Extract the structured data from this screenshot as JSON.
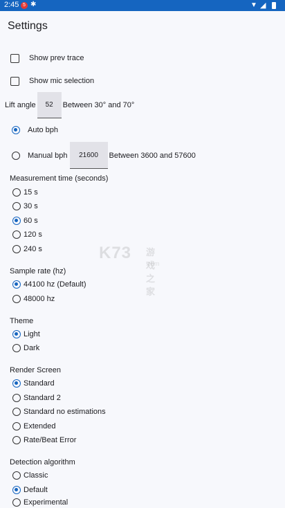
{
  "status_bar": {
    "time": "2:45",
    "notification_badge": "5",
    "app_icon": "bug-icon",
    "wifi_icon": "wifi-icon",
    "signal_icon": "signal-icon",
    "battery_icon": "battery-icon"
  },
  "title": "Settings",
  "checkboxes": [
    {
      "label": "Show prev trace",
      "checked": false
    },
    {
      "label": "Show mic selection",
      "checked": false
    }
  ],
  "lift_angle": {
    "label": "Lift angle",
    "value": "52",
    "hint": "Between 30° and 70°"
  },
  "bph": {
    "auto_label": "Auto bph",
    "manual_label": "Manual bph",
    "manual_value": "21600",
    "manual_hint": "Between 3600 and 57600",
    "selected": "auto"
  },
  "measurement_time": {
    "header": "Measurement time (seconds)",
    "options": [
      "15 s",
      "30 s",
      "60 s",
      "120 s",
      "240 s"
    ],
    "selected": "60 s"
  },
  "sample_rate": {
    "header": "Sample rate (hz)",
    "options": [
      "44100 hz (Default)",
      "48000 hz"
    ],
    "selected": "44100 hz (Default)"
  },
  "theme": {
    "header": "Theme",
    "options": [
      "Light",
      "Dark"
    ],
    "selected": "Light"
  },
  "render_screen": {
    "header": "Render Screen",
    "options": [
      "Standard",
      "Standard 2",
      "Standard no estimations",
      "Extended",
      "Rate/Beat Error"
    ],
    "selected": "Standard"
  },
  "detection_algorithm": {
    "header": "Detection algorithm",
    "options": [
      "Classic",
      "Default",
      "Experimental"
    ],
    "selected": "Default"
  },
  "watermark": {
    "text": "K73",
    "cn": "游戏之家",
    "sub": ".com"
  },
  "colors": {
    "status_bar": "#1565c0",
    "accent": "#1565c0",
    "background": "#f7f8fc"
  }
}
